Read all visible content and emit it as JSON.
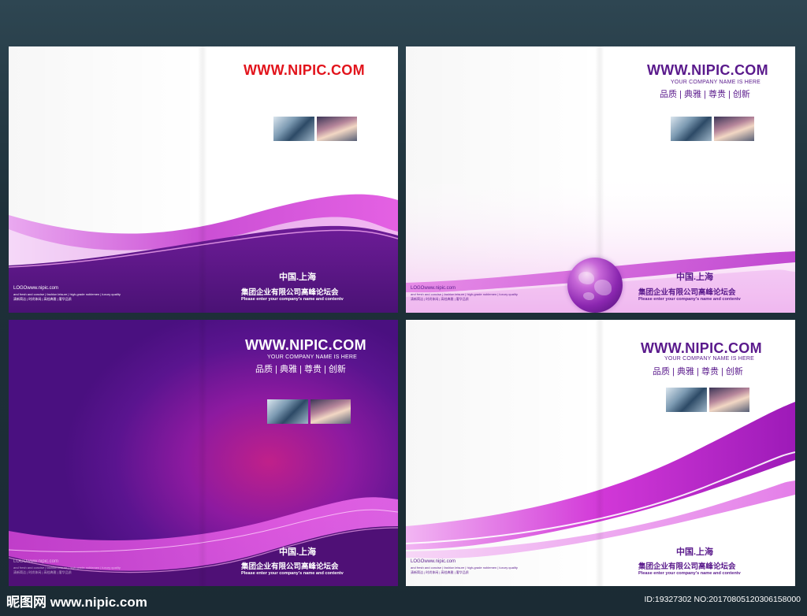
{
  "panels": [
    {
      "url": "WWW.NIPIC.COM",
      "city": "中国.上海",
      "company": "集团企业有限公司高峰论坛会",
      "subtitle": "Please enter your company's name and contentv",
      "logo": "LOGOwww.nipic.com",
      "fine1": "and fresh and concise | fashion leisure | high-grade noblemen | luxury quality",
      "fine2": "清新简洁 | 时尚休闲 | 高档典雅 | 奢华品质"
    },
    {
      "url": "WWW.NIPIC.COM",
      "tagline": "YOUR COMPANY NAME IS HERE",
      "values": "品质 | 典雅 | 尊贵 | 创新",
      "city": "中国.上海",
      "company": "集团企业有限公司高峰论坛会",
      "subtitle": "Please enter your company's name and contentv",
      "logo": "LOGOwww.nipic.com",
      "fine1": "and fresh and concise | fashion leisure | high-grade noblemen | luxury quality",
      "fine2": "清新简洁 | 时尚休闲 | 高档典雅 | 奢华品质"
    },
    {
      "url": "WWW.NIPIC.COM",
      "tagline": "YOUR COMPANY NAME IS HERE",
      "values": "品质 | 典雅 | 尊贵 | 创新",
      "city": "中国.上海",
      "company": "集团企业有限公司高峰论坛会",
      "subtitle": "Please enter your company's name and contentv",
      "logo": "LOGOwww.nipic.com",
      "fine1": "and fresh and concise | fashion leisure | high-grade noblemen | luxury quality",
      "fine2": "清新简洁 | 时尚休闲 | 高档典雅 | 奢华品质"
    },
    {
      "url": "WWW.NIPIC.COM",
      "tagline": "YOUR COMPANY NAME IS HERE",
      "values": "品质 | 典雅 | 尊贵 | 创新",
      "city": "中国.上海",
      "company": "集团企业有限公司高峰论坛会",
      "subtitle": "Please enter your company's name and contentv",
      "logo": "LOGOwww.nipic.com",
      "fine1": "and fresh and concise | fashion leisure | high-grade noblemen | luxury quality",
      "fine2": "清新简洁 | 时尚休闲 | 高档典雅 | 奢华品质"
    }
  ],
  "footer": {
    "site_logo": "昵图网 www.nipic.com",
    "image_id": "ID:19327302 NO:20170805120306158000"
  },
  "colors": {
    "accent_purple": "#5a1a8c",
    "magenta": "#d12fd6",
    "url_red": "#e2141c"
  },
  "icons": {
    "globe": "globe-icon",
    "photo_building": "building-photo",
    "photo_bridge": "bridge-photo"
  }
}
